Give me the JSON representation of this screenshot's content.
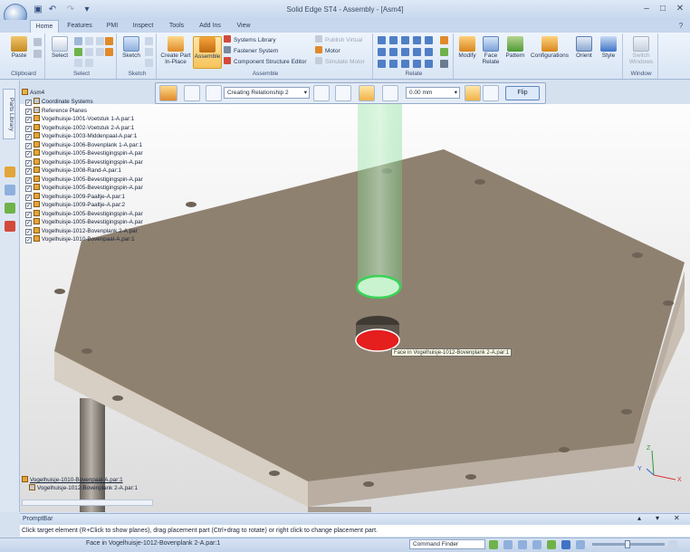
{
  "window": {
    "title": "Solid Edge ST4 - Assembly - [Asm4]",
    "help_icon": "?"
  },
  "tabs": [
    "Home",
    "Features",
    "PMI",
    "Inspect",
    "Tools",
    "Add Ins",
    "View"
  ],
  "ribbon": {
    "groups": {
      "clipboard": "Clipboard",
      "select": "Select",
      "sketch": "Sketch",
      "assemble": "Assemble",
      "relate": "Relate",
      "window": "Window"
    },
    "buttons": {
      "paste": "Paste",
      "select": "Select",
      "sketch": "Sketch",
      "create_part_line1": "Create Part",
      "create_part_line2": "In-Place",
      "assemble": "Assemble",
      "systems_library": "Systems Library",
      "fastener_system": "Fastener System",
      "component_structure_editor": "Component Structure Editor",
      "publish_virtual": "Publish Virtual",
      "motor": "Motor",
      "simulate_motor": "Simulate Motor",
      "modify": "Modify",
      "face_relate": "Face Relate",
      "pattern": "Pattern",
      "configurations": "Configurations",
      "orient": "Orient",
      "style": "Style",
      "switch_windows_line1": "Switch",
      "switch_windows_line2": "Windows"
    }
  },
  "sidebar": {
    "parts_library": "Parts Library"
  },
  "tree": {
    "root": "Asm4",
    "items": [
      "Coordinate Systems",
      "Reference Planes",
      "Vogelhuisje-1001-Voetstuk 1-A.par:1",
      "Vogelhuisje-1002-Voetstuk 2-A.par:1",
      "Vogelhuisje-1003-Middenpaal-A.par:1",
      "Vogelhuisje-1006-Bovenplank 1-A.par:1",
      "Vogelhuisje-1005-Bevestigingspin-A.par",
      "Vogelhuisje-1005-Bevestigingspin-A.par",
      "Vogelhuisje-1008-Rand-A.par:1",
      "Vogelhuisje-1005-Bevestigingspin-A.par",
      "Vogelhuisje-1005-Bevestigingspin-A.par",
      "Vogelhuisje-1009-Paaltje-A.par:1",
      "Vogelhuisje-1009-Paaltje-A.par:2",
      "Vogelhuisje-1005-Bevestigingspin-A.par",
      "Vogelhuisje-1005-Bevestigingspin-A.par",
      "Vogelhuisje-1012-Bovenplank 2-A.par",
      "Vogelhuisje-1010-Bovenpaal-A.par:1"
    ],
    "lower_items": [
      "Vogelhuisje-1010-Bovenpaal-A.par:1",
      "Vogelhuisje-1012-Bovenplank 2-A.par:1"
    ]
  },
  "command_bar": {
    "relationship": "Creating Relationship 2",
    "offset": "0.00 mm",
    "flip": "Flip"
  },
  "viewport": {
    "tooltip": "Face in Vogelhuisje-1012-Bovenplank 2-A.par:1"
  },
  "prompt": {
    "title": "PromptBar",
    "text": "Click target element (R+Click to show planes), drag placement part (Ctrl+drag to rotate) or right click to change placement part."
  },
  "status": {
    "text": "Face in Vogelhuisje-1012-Bovenplank 2-A.par:1",
    "command_finder": "Command Finder"
  },
  "colors": {
    "accent": "#f0a020",
    "plate": "#8f8170",
    "highlight_green": "#57d66a",
    "highlight_red": "#e51e1e"
  }
}
